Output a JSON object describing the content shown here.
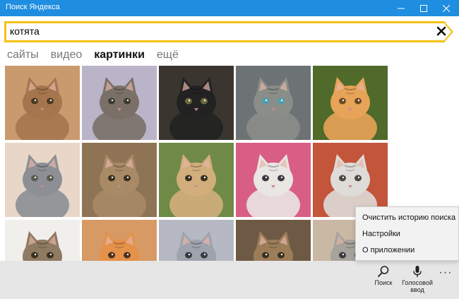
{
  "window": {
    "title": "Поиск Яндекса",
    "controls": [
      "minimize-icon",
      "maximize-icon",
      "close-icon"
    ]
  },
  "search": {
    "value": "котята",
    "clear_icon": "clear-x-icon",
    "accent": "#f7c215"
  },
  "tabs": [
    {
      "label": "сайты",
      "active": false
    },
    {
      "label": "видео",
      "active": false
    },
    {
      "label": "картинки",
      "active": true
    },
    {
      "label": "ещё",
      "active": false
    }
  ],
  "results": {
    "images": [
      {
        "alt": "fluffy tabby kitten",
        "bg": "#c89a6e",
        "fur": "#a5764e",
        "eye": "#4a3a20"
      },
      {
        "alt": "tabby kitten on blanket",
        "bg": "#b9b4c8",
        "fur": "#7a7068",
        "eye": "#3a3a30"
      },
      {
        "alt": "black and white kitten",
        "bg": "#3b3530",
        "fur": "#222222",
        "eye": "#6c6a40"
      },
      {
        "alt": "grey tabby kitten blue eyes",
        "bg": "#6d7275",
        "fur": "#8a8d88",
        "eye": "#4aa0b0"
      },
      {
        "alt": "two ginger kittens",
        "bg": "#4f6a2a",
        "fur": "#e7a357",
        "eye": "#6a4a20"
      },
      {
        "alt": "grey kittens group",
        "bg": "#e8d6c8",
        "fur": "#8c8f94",
        "eye": "#5a5a50"
      },
      {
        "alt": "tabby kittens pile",
        "bg": "#8e7455",
        "fur": "#a98a66",
        "eye": "#3a3020"
      },
      {
        "alt": "kitten with flowers",
        "bg": "#6e8a46",
        "fur": "#d2ae7c",
        "eye": "#3a3020"
      },
      {
        "alt": "white kitten on pink",
        "bg": "#d95e86",
        "fur": "#e9e6e4",
        "eye": "#3a3a40"
      },
      {
        "alt": "white kittens",
        "bg": "#c3553a",
        "fur": "#dedcd9",
        "eye": "#4a4a40"
      },
      {
        "alt": "two tabby kittens",
        "bg": "#f1efec",
        "fur": "#8f7a62",
        "eye": "#3a3020"
      },
      {
        "alt": "ginger kitten",
        "bg": "#d89a64",
        "fur": "#e4914a",
        "eye": "#4a3020"
      },
      {
        "alt": "grey kitten",
        "bg": "#b6b9c3",
        "fur": "#9ea3ad",
        "eye": "#3a3a40"
      },
      {
        "alt": "tabby kitten close up",
        "bg": "#6e5a44",
        "fur": "#9c7d5a",
        "eye": "#3a3020"
      },
      {
        "alt": "grey kitten in box",
        "bg": "#c9b8a4",
        "fur": "#a6a29c",
        "eye": "#3a3a40"
      }
    ]
  },
  "context_menu": {
    "items": [
      "Очистить историю поиска",
      "Настройки",
      "О приложении"
    ]
  },
  "command_bar": {
    "search_label": "Поиск",
    "voice_label_line1": "Голосовой",
    "voice_label_line2": "ввод",
    "more_label": "···",
    "search_icon": "search-icon",
    "voice_icon": "microphone-icon"
  }
}
